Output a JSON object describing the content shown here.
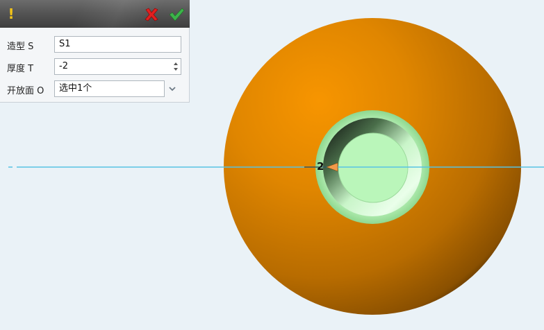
{
  "panel": {
    "fields": [
      {
        "label": "造型 S",
        "value": "S1"
      },
      {
        "label": "厚度 T",
        "value": "-2"
      },
      {
        "label": "开放面 O",
        "value": "选中1个"
      }
    ]
  },
  "icons": {
    "warning": "exclamation-icon",
    "cancel": "red-x-icon",
    "confirm": "green-checkmark-icon",
    "stepper": "up-down-stepper-icon",
    "dropdown": "chevron-down-icon"
  },
  "viewport": {
    "dimension_label": "2"
  },
  "colors": {
    "background": "#eaf2f7",
    "shell_orange": "#e68a00",
    "opening_green": "#b8f0b8",
    "axis_blue": "#57c3e3",
    "cancel_red": "#e02020",
    "confirm_green": "#3cb34a",
    "warning_yellow": "#f2c318"
  }
}
